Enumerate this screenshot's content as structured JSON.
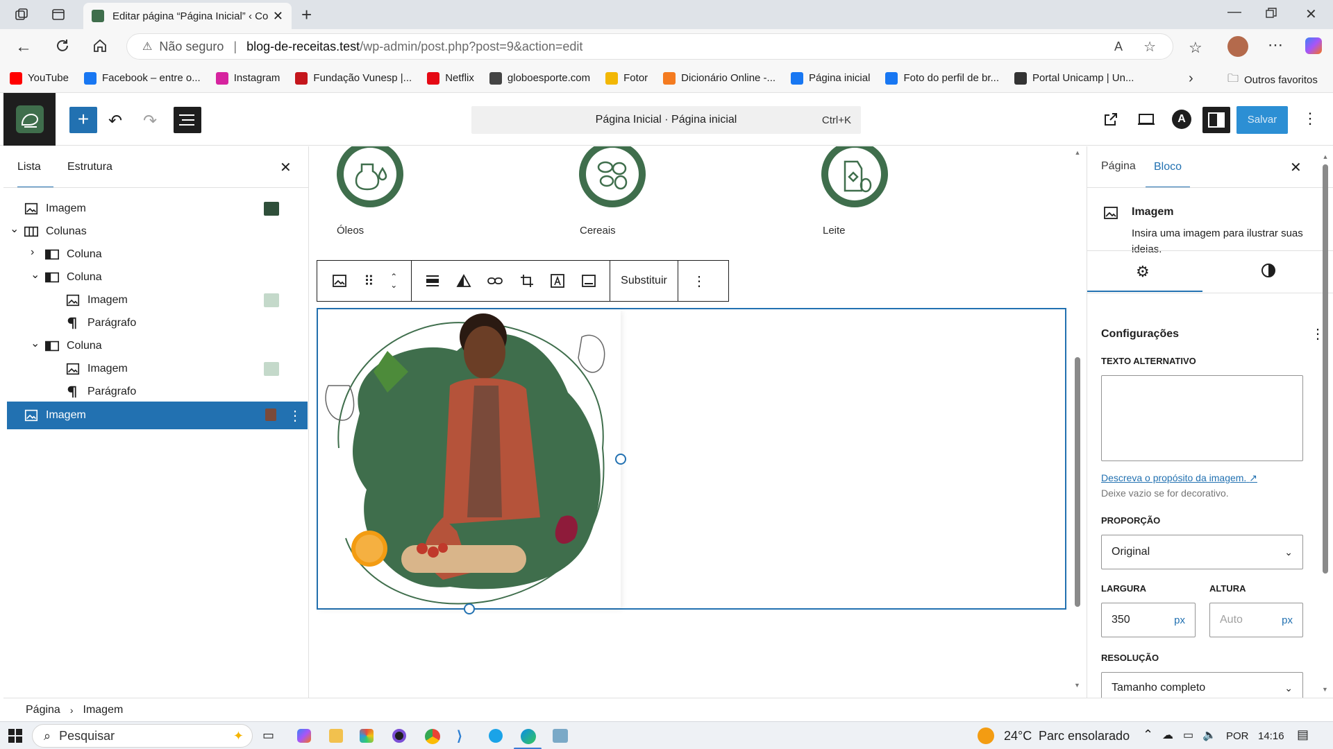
{
  "browser": {
    "tab_title": "Editar página “Página Inicial” ‹ Co",
    "url_warning": "Não seguro",
    "url_host": "blog-de-receitas.test",
    "url_path": "/wp-admin/post.php?post=9&action=edit",
    "bookmarks": [
      {
        "label": "YouTube",
        "icon": "youtube-icon",
        "color": "#ff0000"
      },
      {
        "label": "Facebook – entre o...",
        "icon": "facebook-icon",
        "color": "#1877f2"
      },
      {
        "label": "Instagram",
        "icon": "instagram-icon",
        "color": "#d6249f"
      },
      {
        "label": "Fundação Vunesp |...",
        "icon": "vunesp-icon",
        "color": "#c4161c"
      },
      {
        "label": "Netflix",
        "icon": "netflix-icon",
        "color": "#e50914"
      },
      {
        "label": "globoesporte.com",
        "icon": "globe-icon",
        "color": "#444444"
      },
      {
        "label": "Fotor",
        "icon": "fotor-icon",
        "color": "#f2b705"
      },
      {
        "label": "Dicionário Online -...",
        "icon": "dicio-icon",
        "color": "#f47b20"
      },
      {
        "label": "Página inicial",
        "icon": "facebook-page-icon",
        "color": "#1877f2"
      },
      {
        "label": "Foto do perfil de br...",
        "icon": "facebook-photo-icon",
        "color": "#1877f2"
      },
      {
        "label": "Portal Unicamp | Un...",
        "icon": "unicamp-icon",
        "color": "#333333"
      }
    ],
    "other_favorites": "Outros favoritos"
  },
  "editor": {
    "command_title": "Página Inicial · Página inicial",
    "command_shortcut": "Ctrl+K",
    "save_label": "Salvar"
  },
  "left_panel": {
    "tabs": [
      "Lista",
      "Estrutura"
    ],
    "tree": [
      {
        "label": "Imagem",
        "icon": "image-icon",
        "indent": 0,
        "chevron": ""
      },
      {
        "label": "Colunas",
        "icon": "columns-icon",
        "indent": 0,
        "chevron": "down"
      },
      {
        "label": "Coluna",
        "icon": "column-icon",
        "indent": 1,
        "chevron": "right"
      },
      {
        "label": "Coluna",
        "icon": "column-icon",
        "indent": 1,
        "chevron": "down"
      },
      {
        "label": "Imagem",
        "icon": "image-icon",
        "indent": 2,
        "chevron": ""
      },
      {
        "label": "Parágrafo",
        "icon": "paragraph-icon",
        "indent": 2,
        "chevron": ""
      },
      {
        "label": "Coluna",
        "icon": "column-icon",
        "indent": 1,
        "chevron": "down"
      },
      {
        "label": "Imagem",
        "icon": "image-icon",
        "indent": 2,
        "chevron": ""
      },
      {
        "label": "Parágrafo",
        "icon": "paragraph-icon",
        "indent": 2,
        "chevron": ""
      },
      {
        "label": "Imagem",
        "icon": "image-icon",
        "indent": 0,
        "chevron": "",
        "selected": true
      }
    ]
  },
  "canvas": {
    "categories": [
      "Óleos",
      "Cereais",
      "Leite"
    ],
    "toolbar_replace": "Substituir",
    "brand_green": "#3f6e4c"
  },
  "right_panel": {
    "tabs": [
      "Página",
      "Bloco"
    ],
    "block_title": "Imagem",
    "block_description": "Insira uma imagem para ilustrar suas ideias.",
    "section_title": "Configurações",
    "alt_label": "TEXTO ALTERNATIVO",
    "alt_value": "",
    "alt_help_link": "Descreva o propósito da imagem.",
    "alt_help_text": "Deixe vazio se for decorativo.",
    "aspect_label": "PROPORÇÃO",
    "aspect_value": "Original",
    "width_label": "LARGURA",
    "width_value": "350",
    "width_unit": "px",
    "height_label": "ALTURA",
    "height_placeholder": "Auto",
    "height_unit": "px",
    "resolution_label": "RESOLUÇÃO",
    "resolution_value": "Tamanho completo"
  },
  "breadcrumb": [
    "Página",
    "Imagem"
  ],
  "taskbar": {
    "search_placeholder": "Pesquisar",
    "weather_temp": "24°C",
    "weather_text": "Parc ensolarado",
    "language": "POR",
    "time": "14:16"
  }
}
